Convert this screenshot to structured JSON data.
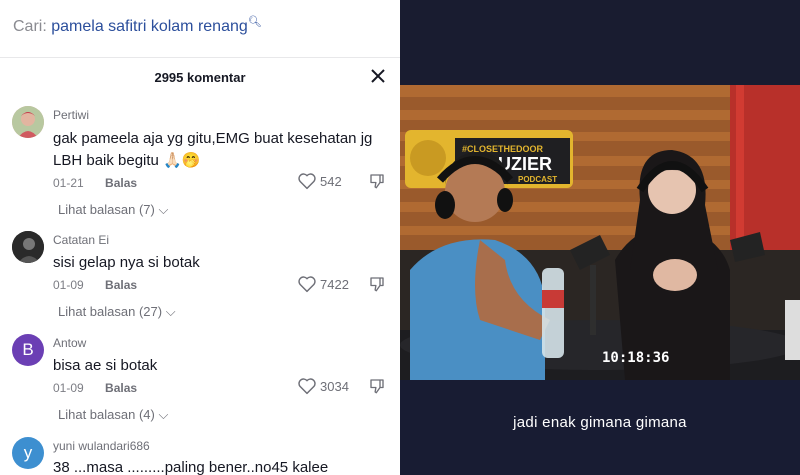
{
  "search": {
    "label": "Cari:",
    "query": "pamela safitri kolam renang"
  },
  "comments_header": {
    "count": "2995 komentar"
  },
  "comments": [
    {
      "username": "Pertiwi",
      "text1": "gak pameela aja yg gitu,EMG buat kesehatan jg",
      "text2": "LBH baik begitu 🙏🏻🤭",
      "date": "01-21",
      "reply": "Balas",
      "likes": "542",
      "more": "Lihat balasan (7)"
    },
    {
      "username": "Catatan Ei",
      "text1": "sisi gelap nya si botak",
      "date": "01-09",
      "reply": "Balas",
      "likes": "7422",
      "more": "Lihat balasan (27)"
    },
    {
      "username": "Antow",
      "avatar_letter": "B",
      "text1": "bisa ae si botak",
      "date": "01-09",
      "reply": "Balas",
      "likes": "3034",
      "more": "Lihat balasan (4)"
    },
    {
      "username": "yuni wulandari686",
      "avatar_letter": "y",
      "text1": "38 ...masa .........paling bener..no45 kalee"
    }
  ],
  "video": {
    "logo_top": "#CLOSETHEDOOR",
    "logo_main": "RBUZIER",
    "logo_sub": "PODCAST",
    "timestamp": "10:18:36",
    "caption": "jadi enak gimana gimana"
  },
  "colors": {
    "query": "#2c4f9c",
    "avatar_b": "#6b3fb4",
    "avatar_y": "#3d8fd0",
    "video_bg": "#181c33"
  }
}
